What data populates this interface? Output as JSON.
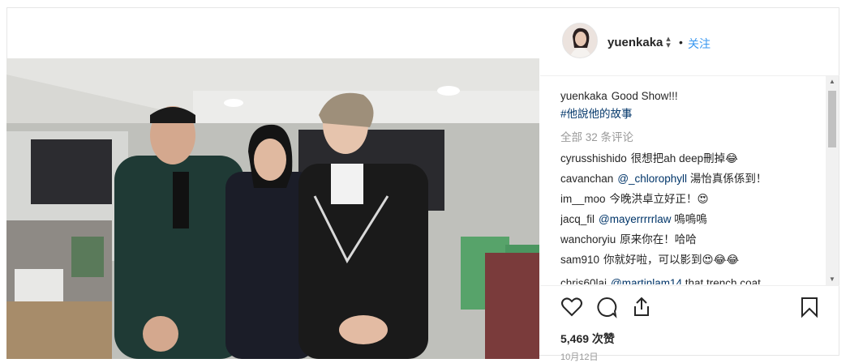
{
  "post": {
    "username": "yuenkaka",
    "dot": "•",
    "follow_label": "关注",
    "caption": {
      "username": "yuenkaka",
      "text": "Good Show!!!",
      "hashtag": "#他說他的故事"
    },
    "all_comments_label": "全部 32 条评论",
    "comments": [
      {
        "user": "cyrusshishido",
        "text": "很想把ah deep刪掉😂"
      },
      {
        "user": "cavanchan",
        "mention": "@_chlorophyll",
        "text": "湯怡真係係到！"
      },
      {
        "user": "im__moo",
        "text": "今晚洪卓立好正！😍"
      },
      {
        "user": "jacq_fil",
        "mention": "@mayerrrrrlaw",
        "text": "嗚嗚嗚"
      },
      {
        "user": "wanchoryiu",
        "text": "原来你在！哈哈"
      },
      {
        "user": "sam910",
        "text": "你就好啦，可以影到😍😂😂"
      },
      {
        "user": "chris60lai",
        "mention": "@martinlam14",
        "text": "that trench coat"
      }
    ],
    "likes": "5,469 次赞",
    "date": "10月12日",
    "icons": [
      "heart-icon",
      "comment-icon",
      "share-icon",
      "bookmark-icon"
    ]
  }
}
